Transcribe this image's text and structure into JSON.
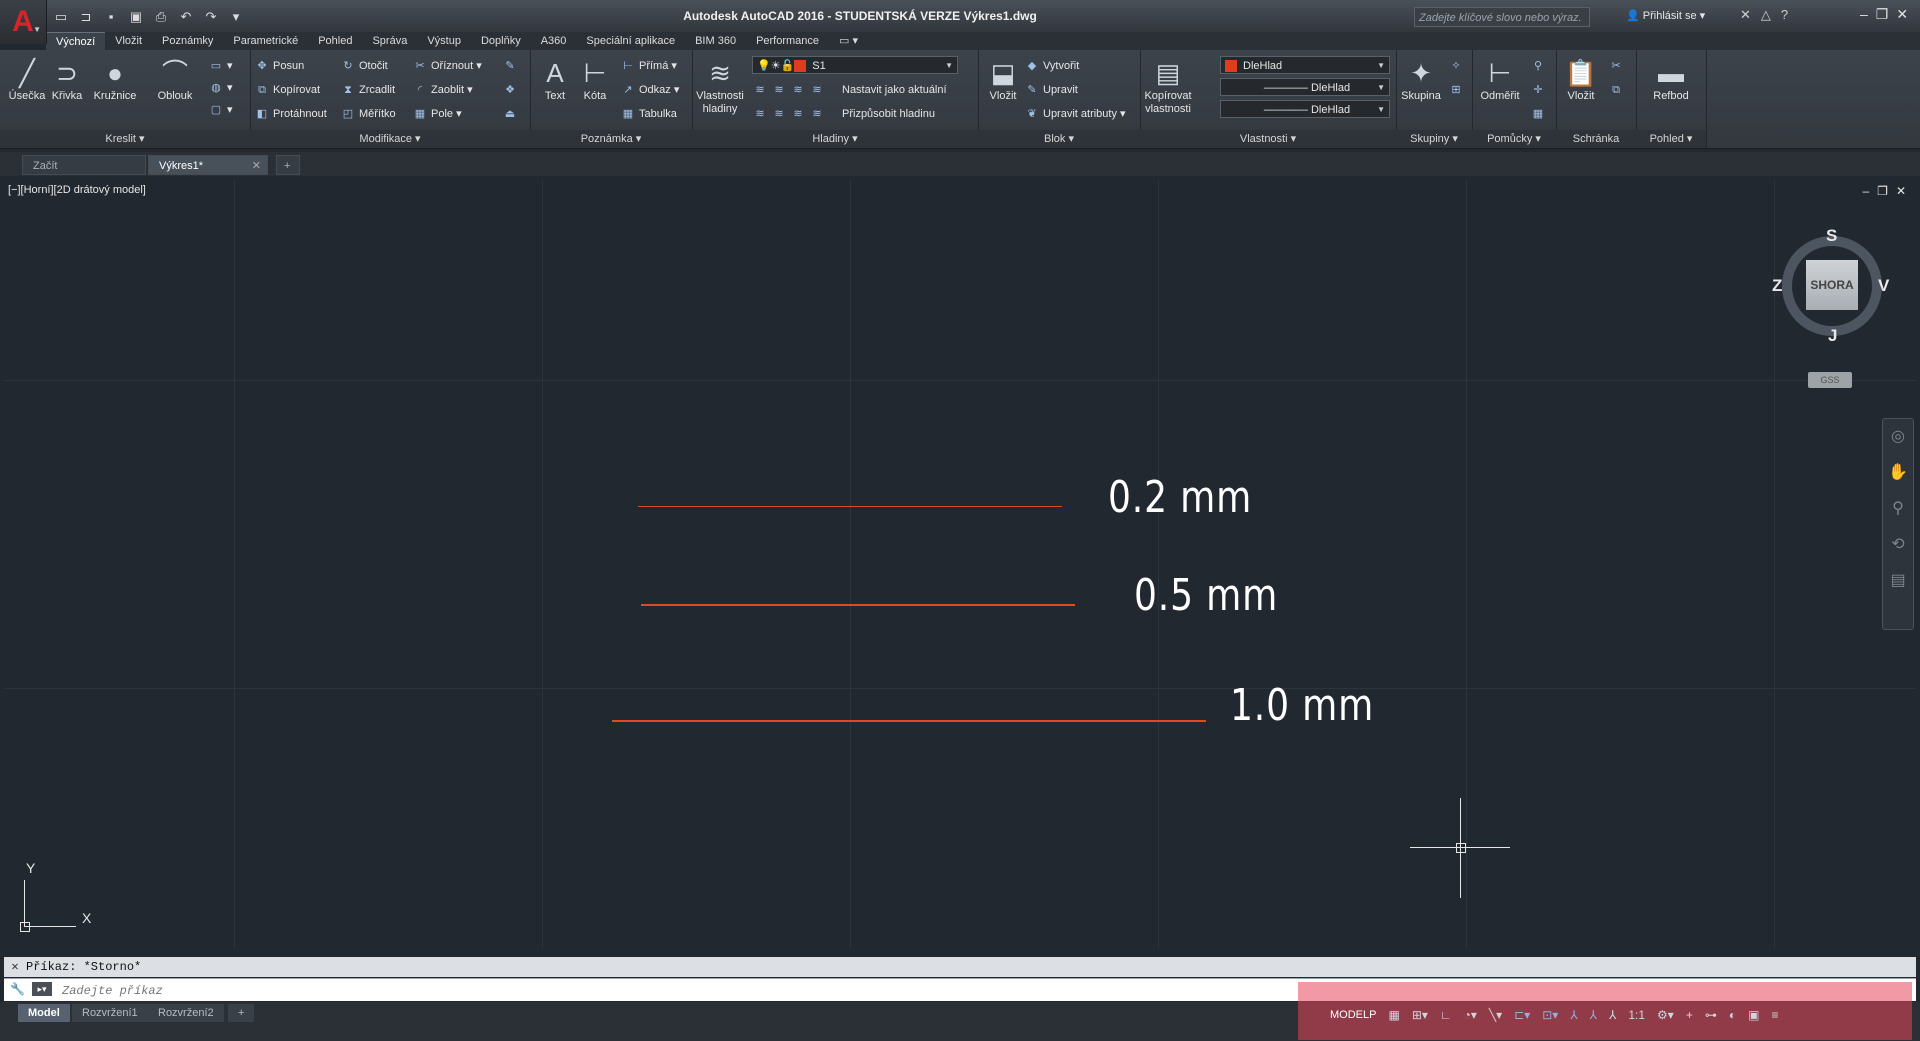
{
  "app": {
    "title": "Autodesk AutoCAD 2016 - STUDENTSKÁ VERZE   Výkres1.dwg",
    "search_placeholder": "Zadejte klíčové slovo nebo výraz.",
    "sign_in": "Přihlásit se"
  },
  "ribbon_tabs": [
    "Výchozí",
    "Vložit",
    "Poznámky",
    "Parametrické",
    "Pohled",
    "Správa",
    "Výstup",
    "Doplňky",
    "A360",
    "Speciální aplikace",
    "BIM 360",
    "Performance"
  ],
  "panels": {
    "kreslit": {
      "title": "Kreslit",
      "buttons": [
        "Úsečka",
        "Křivka",
        "Kružnice",
        "Oblouk"
      ]
    },
    "modifikace": {
      "title": "Modifikace",
      "items": [
        "Posun",
        "Kopírovat",
        "Protáhnout",
        "Otočit",
        "Zrcadlit",
        "Měřítko",
        "Oříznout",
        "Zaoblit",
        "Pole"
      ]
    },
    "poznamka": {
      "title": "Poznámka",
      "big": [
        "Text",
        "Kóta"
      ],
      "items": [
        "Přímá",
        "Odkaz",
        "Tabulka"
      ]
    },
    "hladiny": {
      "title": "Hladiny",
      "big": "Vlastnosti hladiny",
      "layer_combo": "S1",
      "items": [
        "Nastavit jako aktuální",
        "Přizpůsobit hladinu"
      ]
    },
    "blok": {
      "title": "Blok",
      "big": "Vložit",
      "items": [
        "Vytvořit",
        "Upravit",
        "Upravit atributy"
      ]
    },
    "vlastnosti": {
      "title": "Vlastnosti",
      "big": "Kopírovat vlastnosti",
      "combos": [
        "DleHlad",
        "DleHlad",
        "DleHlad"
      ]
    },
    "skupiny": {
      "title": "Skupiny",
      "big": "Skupina"
    },
    "pomucky": {
      "title": "Pomůcky",
      "big": "Odměřit"
    },
    "schranka": {
      "title": "Schránka",
      "big": "Vložit"
    },
    "pohled": {
      "title": "Pohled",
      "big": "Refbod"
    }
  },
  "doc_tabs": [
    "Začít",
    "Výkres1*"
  ],
  "viewport": {
    "label": "[−][Horní][2D drátový model]"
  },
  "drawing": {
    "labels": [
      "0.2 mm",
      "0.5 mm",
      "1.0 mm"
    ],
    "line_color": "#e04a1e"
  },
  "viewcube": {
    "face": "SHORA",
    "north": "S",
    "south": "J",
    "west": "Z",
    "east": "V",
    "wcs": "GSS"
  },
  "ucs": {
    "x": "X",
    "y": "Y"
  },
  "command": {
    "history": "Příkaz: *Storno*",
    "placeholder": "Zadejte příkaz"
  },
  "layout_tabs": [
    "Model",
    "Rozvržení1",
    "Rozvržení2"
  ],
  "status": {
    "model": "MODELP",
    "scale": "1:1"
  }
}
